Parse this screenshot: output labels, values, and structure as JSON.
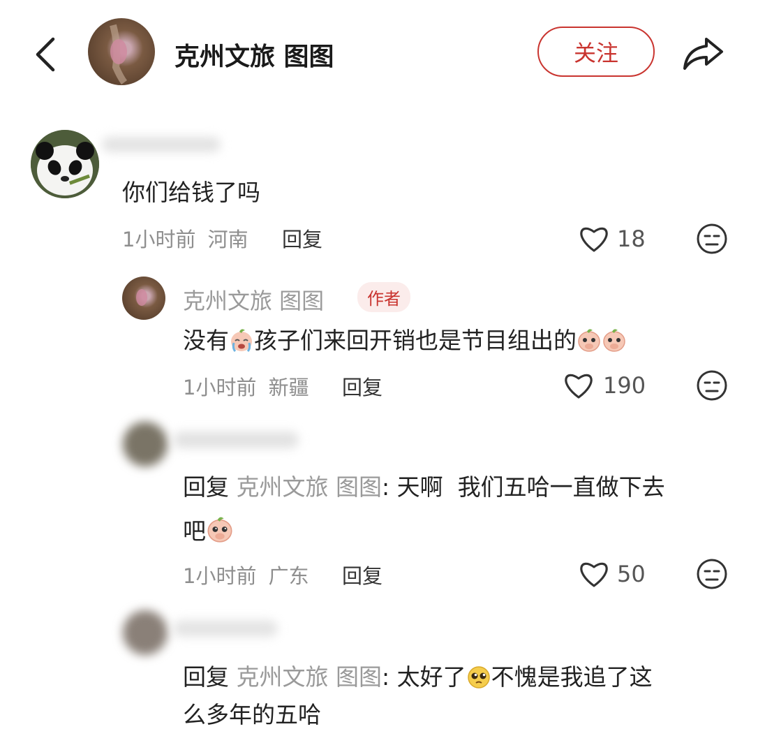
{
  "header": {
    "account_name": "克州文旅 图图",
    "follow_label": "关注"
  },
  "colors": {
    "accent": "#c9342f",
    "muted_text": "#8e8e8e",
    "author_badge_bg": "#fbeceb"
  },
  "comments": [
    {
      "text": "你们给钱了吗",
      "time": "1小时前",
      "location": "河南",
      "reply_label": "回复",
      "likes": "18"
    },
    {
      "author": "克州文旅 图图",
      "badge": "作者",
      "text_a": "没有",
      "text_b": "孩子们来回开销也是节目组出的",
      "time": "1小时前",
      "location": "新疆",
      "reply_label": "回复",
      "likes": "190"
    },
    {
      "prefix": "回复",
      "mention": "克州文旅 图图",
      "colon": ":",
      "text_a": "天啊  我们五哈一直做下去",
      "text_b": "吧",
      "time": "1小时前",
      "location": "广东",
      "reply_label": "回复",
      "likes": "50"
    },
    {
      "prefix": "回复",
      "mention": "克州文旅 图图",
      "colon": ":",
      "text_a": "太好了",
      "text_b": "不愧是我追了这",
      "text_c": "么多年的五哈"
    }
  ],
  "icons": [
    "back-chevron-icon",
    "share-icon",
    "heart-icon",
    "dislike-face-icon",
    "crying-face-emoji",
    "peach-emoji",
    "pleading-face-emoji"
  ]
}
